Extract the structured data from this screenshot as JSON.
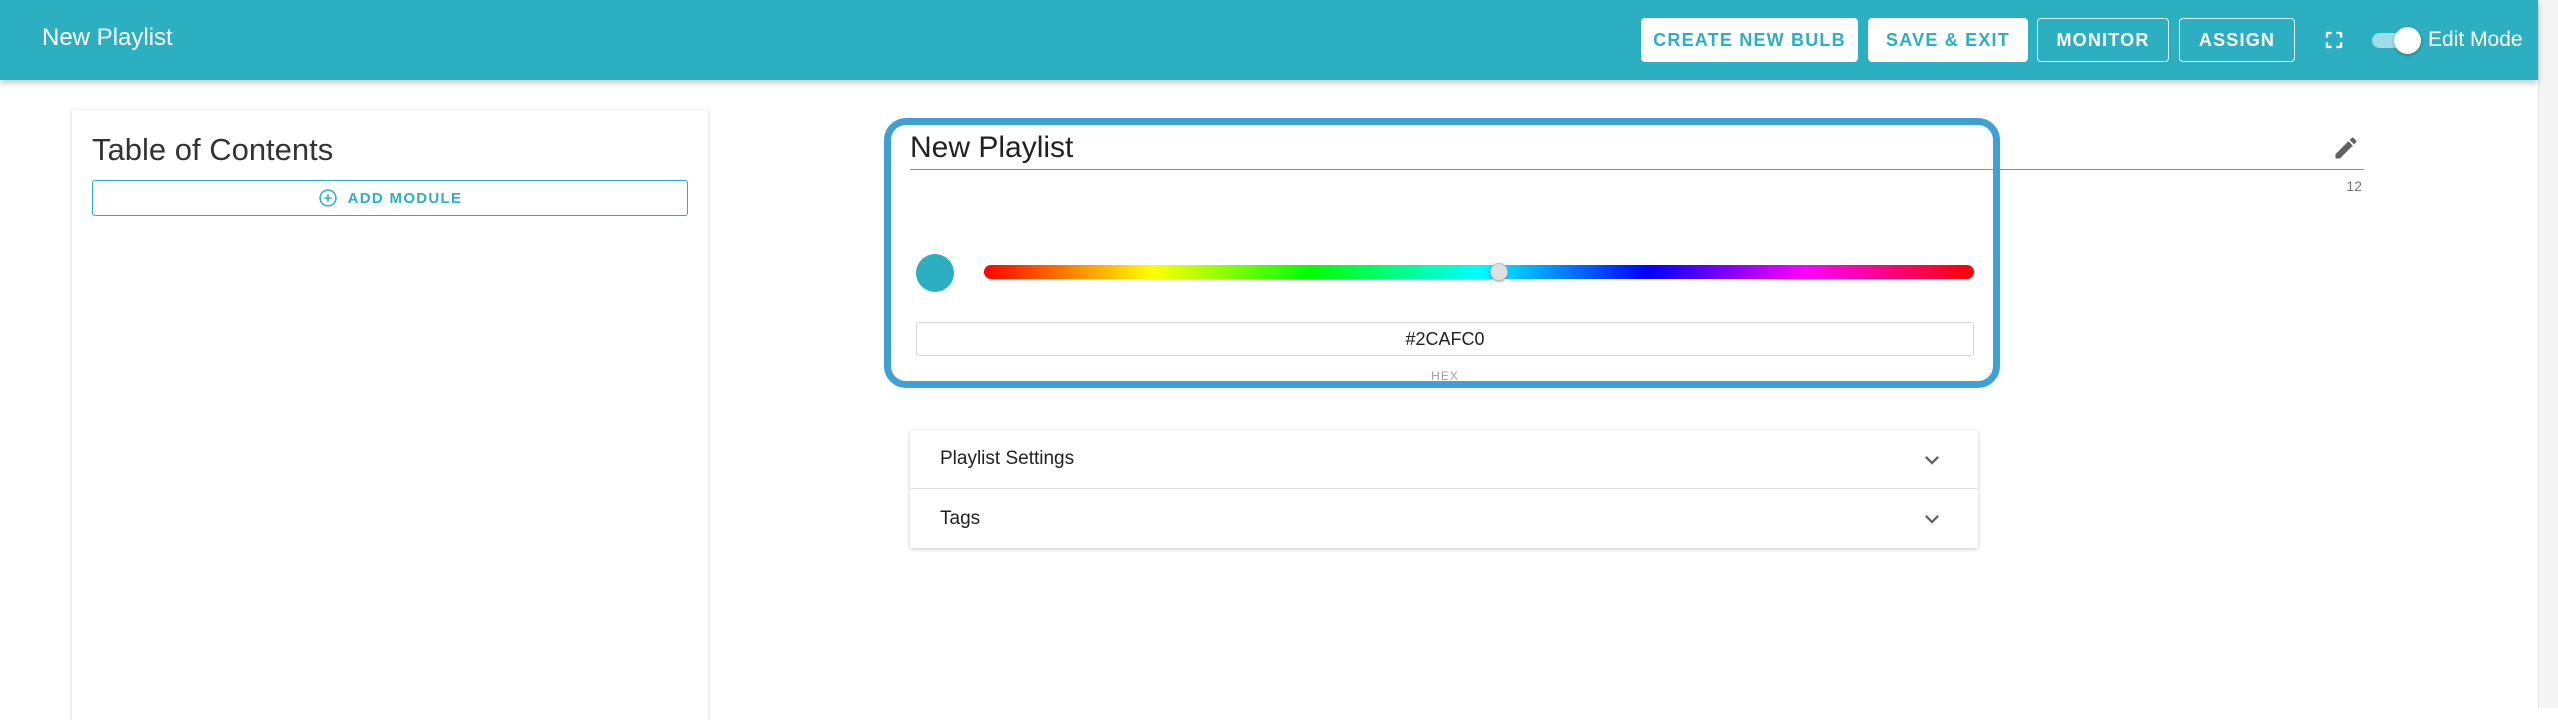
{
  "header": {
    "title": "New Playlist",
    "buttons": {
      "create_new_bulb": "CREATE NEW BULB",
      "save_exit": "SAVE & EXIT",
      "monitor": "MONITOR",
      "assign": "ASSIGN"
    },
    "fullscreen_icon": "fullscreen-icon",
    "edit_mode": {
      "label": "Edit Mode",
      "on": true
    }
  },
  "toc": {
    "title": "Table of Contents",
    "add_module_label": "ADD MODULE",
    "add_icon": "add-circle-icon"
  },
  "editor": {
    "playlist_name": "New Playlist",
    "char_count": "12",
    "edit_icon": "pencil-icon",
    "color": {
      "hex_value": "#2CAFC0",
      "hex_label": "HEX",
      "hue_fraction": 0.52
    }
  },
  "accordion": {
    "items": [
      {
        "label": "Playlist Settings",
        "icon": "chevron-down-icon"
      },
      {
        "label": "Tags",
        "icon": "chevron-down-icon"
      }
    ]
  },
  "colors": {
    "brand": "#2CAFC0",
    "highlight": "#3fa0d6"
  }
}
